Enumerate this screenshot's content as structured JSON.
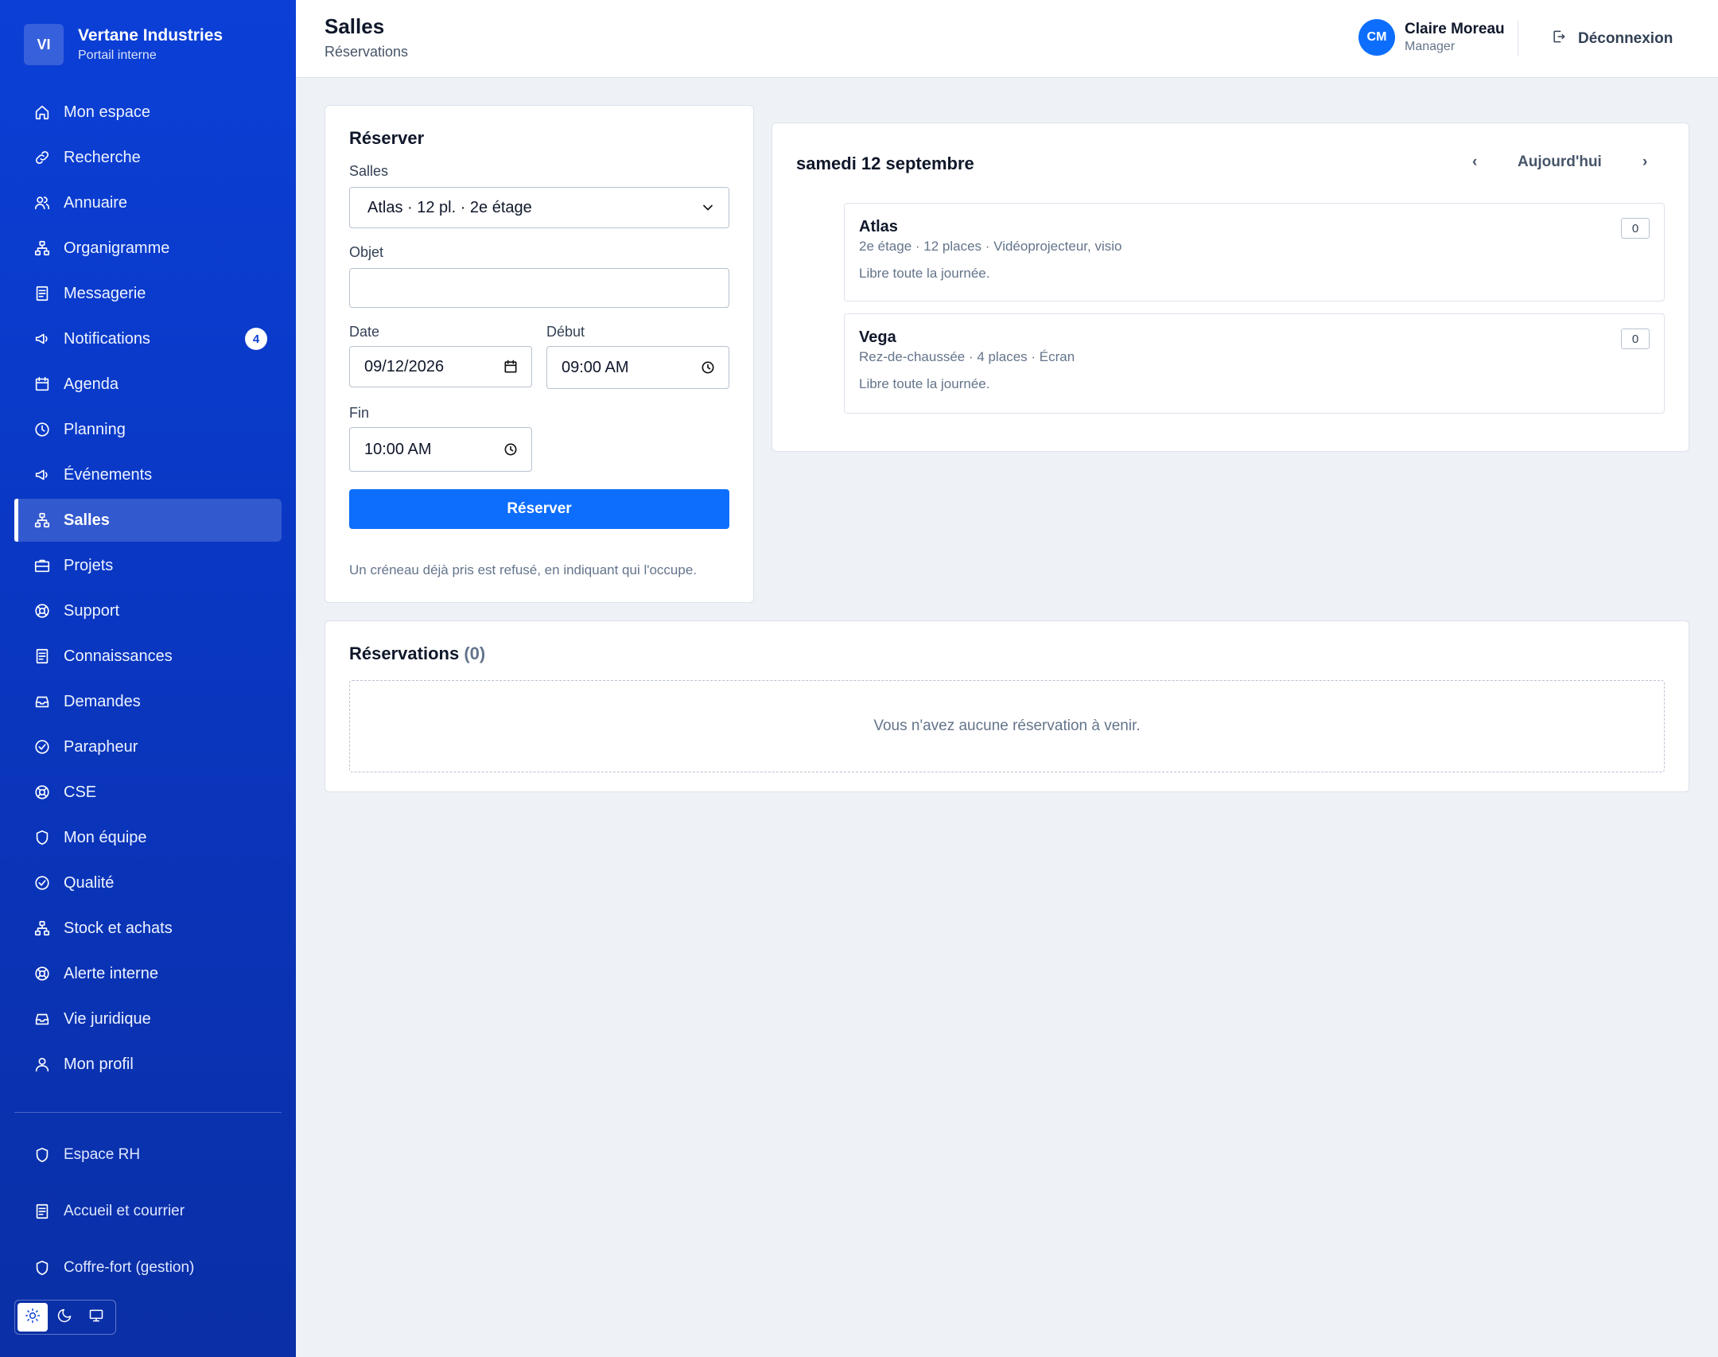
{
  "brand": {
    "logo": "VI",
    "name": "Vertane Industries",
    "subtitle": "Portail interne"
  },
  "sidebar": {
    "items": [
      {
        "label": "Mon espace",
        "icon": "home-icon"
      },
      {
        "label": "Recherche",
        "icon": "link-icon"
      },
      {
        "label": "Annuaire",
        "icon": "users-icon"
      },
      {
        "label": "Organigramme",
        "icon": "org-chart-icon"
      },
      {
        "label": "Messagerie",
        "icon": "document-icon"
      },
      {
        "label": "Notifications",
        "icon": "megaphone-icon",
        "badge": "4"
      },
      {
        "label": "Agenda",
        "icon": "calendar-icon"
      },
      {
        "label": "Planning",
        "icon": "clock-icon"
      },
      {
        "label": "Événements",
        "icon": "megaphone-icon"
      },
      {
        "label": "Salles",
        "icon": "org-chart-icon",
        "active": true
      },
      {
        "label": "Projets",
        "icon": "briefcase-icon"
      },
      {
        "label": "Support",
        "icon": "lifebuoy-icon"
      },
      {
        "label": "Connaissances",
        "icon": "document-icon"
      },
      {
        "label": "Demandes",
        "icon": "inbox-icon"
      },
      {
        "label": "Parapheur",
        "icon": "check-circle-icon"
      },
      {
        "label": "CSE",
        "icon": "lifebuoy-icon"
      },
      {
        "label": "Mon équipe",
        "icon": "shield-icon"
      },
      {
        "label": "Qualité",
        "icon": "check-circle-icon"
      },
      {
        "label": "Stock et achats",
        "icon": "org-chart-icon"
      },
      {
        "label": "Alerte interne",
        "icon": "lifebuoy-icon"
      },
      {
        "label": "Vie juridique",
        "icon": "inbox-icon"
      },
      {
        "label": "Mon profil",
        "icon": "user-icon"
      }
    ],
    "secondary": [
      {
        "label": "Espace RH",
        "icon": "shield-icon"
      },
      {
        "label": "Accueil et courrier",
        "icon": "document-icon"
      },
      {
        "label": "Coffre-fort (gestion)",
        "icon": "shield-icon"
      }
    ],
    "theme": {
      "selected": "light",
      "options": [
        "sun-icon",
        "moon-icon",
        "monitor-icon"
      ]
    }
  },
  "header": {
    "title": "Salles",
    "subtitle": "Réservations",
    "user": {
      "initials": "CM",
      "name": "Claire Moreau",
      "role": "Manager"
    },
    "logout_label": "Déconnexion"
  },
  "booking_form": {
    "title": "Réserver",
    "room_label": "Salles",
    "room_value": "Atlas · 12 pl. · 2e étage",
    "subject_label": "Objet",
    "subject_value": "",
    "date_label": "Date",
    "date_value": "09/12/2026",
    "start_label": "Début",
    "start_value": "09:00 AM",
    "end_label": "Fin",
    "end_value": "10:00 AM",
    "submit_label": "Réserver",
    "hint": "Un créneau déjà pris est refusé, en indiquant qui l'occupe."
  },
  "schedule": {
    "day_title": "samedi 12 septembre",
    "prev_label": "‹",
    "today_label": "Aujourd'hui",
    "next_label": "›",
    "rooms": [
      {
        "name": "Atlas",
        "meta": "2e étage · 12 places · Vidéoprojecteur, visio",
        "status": "Libre toute la journée.",
        "count": "0"
      },
      {
        "name": "Vega",
        "meta": "Rez-de-chaussée · 4 places · Écran",
        "status": "Libre toute la journée.",
        "count": "0"
      }
    ]
  },
  "reservations": {
    "title": "Réservations",
    "count": "(0)",
    "empty_text": "Vous n'avez aucune réservation à venir."
  },
  "colors": {
    "sidebar": "#0b3fd6",
    "primary": "#0d6efd",
    "background": "#eef2f7"
  }
}
